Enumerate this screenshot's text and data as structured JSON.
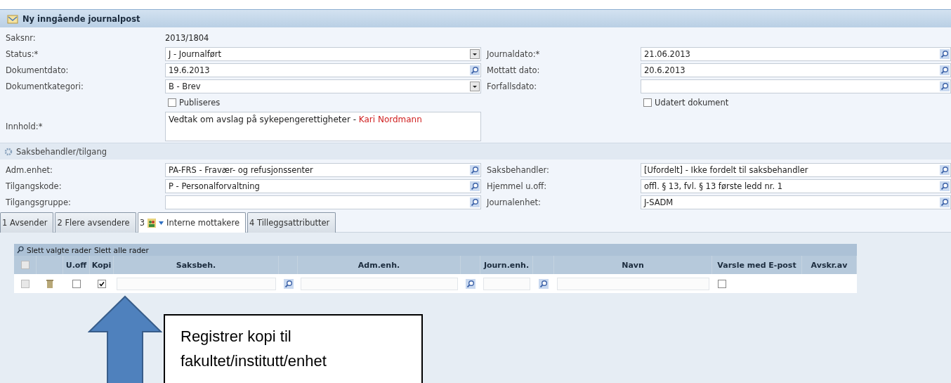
{
  "header": {
    "title": "Ny inngående journalpost"
  },
  "rows": [
    {
      "left": {
        "label": "Saksnr:",
        "kind": "text",
        "value": "2013/1804"
      }
    },
    {
      "left": {
        "label": "Status:*",
        "kind": "dropdown",
        "value": "J - Journalført"
      },
      "right": {
        "label": "Journaldato:*",
        "kind": "lookup",
        "value": "21.06.2013"
      }
    },
    {
      "left": {
        "label": "Dokumentdato:",
        "kind": "lookup",
        "value": "19.6.2013"
      },
      "right": {
        "label": "Mottatt dato:",
        "kind": "lookup",
        "value": "20.6.2013"
      }
    },
    {
      "left": {
        "label": "Dokumentkategori:",
        "kind": "dropdown",
        "value": "B - Brev"
      },
      "right": {
        "label": "Forfallsdato:",
        "kind": "lookup"
      }
    },
    {
      "left": {
        "kind": "checkbox",
        "value": "Publiseres",
        "checked": false
      },
      "right": {
        "kind": "checkbox",
        "value": "Udatert dokument",
        "checked": false
      }
    },
    {
      "left": {
        "label": "Innhold:*",
        "kind": "textarea",
        "value": "Vedtak om avslag på sykepengerettigheter - ",
        "highlight": "Kari Nordmann"
      }
    }
  ],
  "section": {
    "title": "Saksbehandler/tilgang"
  },
  "rows2": [
    {
      "left": {
        "label": "Adm.enhet:",
        "kind": "lookup",
        "value": "PA-FRS - Fravær- og refusjonssenter"
      },
      "right": {
        "label": "Saksbehandler:",
        "kind": "lookup",
        "value": "[Ufordelt] - Ikke fordelt til saksbehandler"
      }
    },
    {
      "left": {
        "label": "Tilgangskode:",
        "kind": "lookup",
        "value": "P - Personalforvaltning"
      },
      "right": {
        "label": "Hjemmel u.off:",
        "kind": "lookup",
        "value": "offl. § 13, fvl. § 13 første ledd nr. 1"
      }
    },
    {
      "left": {
        "label": "Tilgangsgruppe:",
        "kind": "lookup"
      },
      "right": {
        "label": "Journalenhet:",
        "kind": "lookup",
        "value": "J-SADM"
      }
    }
  ],
  "tabs": [
    {
      "number": "1",
      "label": "Avsender",
      "selected": false
    },
    {
      "number": "2",
      "label": "Flere avsendere",
      "selected": false
    },
    {
      "number": "3",
      "label": "Interne mottakere",
      "selected": true
    },
    {
      "number": "4",
      "label": "Tilleggsattributter",
      "selected": false
    }
  ],
  "toolbar": {
    "actions": [
      "Slett valgte rader",
      "Slett alle rader"
    ]
  },
  "table": {
    "all_selected": false,
    "columns": [
      {
        "kind": "select"
      },
      {
        "kind": "blank"
      },
      {
        "kind": "text",
        "label": "U.off"
      },
      {
        "kind": "text",
        "label": "Kopi"
      },
      {
        "kind": "text",
        "label": "Saksbeh."
      },
      {
        "kind": "blank"
      },
      {
        "kind": "text",
        "label": "Adm.enh."
      },
      {
        "kind": "blank"
      },
      {
        "kind": "text",
        "label": "Journ.enh."
      },
      {
        "kind": "blank"
      },
      {
        "kind": "text",
        "label": "Navn"
      },
      {
        "kind": "text",
        "label": "Varsle med E-post"
      },
      {
        "kind": "text",
        "label": "Avskr.av"
      }
    ],
    "rows": [
      {
        "selected": false,
        "uoff": false,
        "kopi": true,
        "varsle": false
      }
    ]
  },
  "callout": {
    "lines": [
      "Registrer kopi til",
      "fakultet/institutt/enhet"
    ]
  }
}
